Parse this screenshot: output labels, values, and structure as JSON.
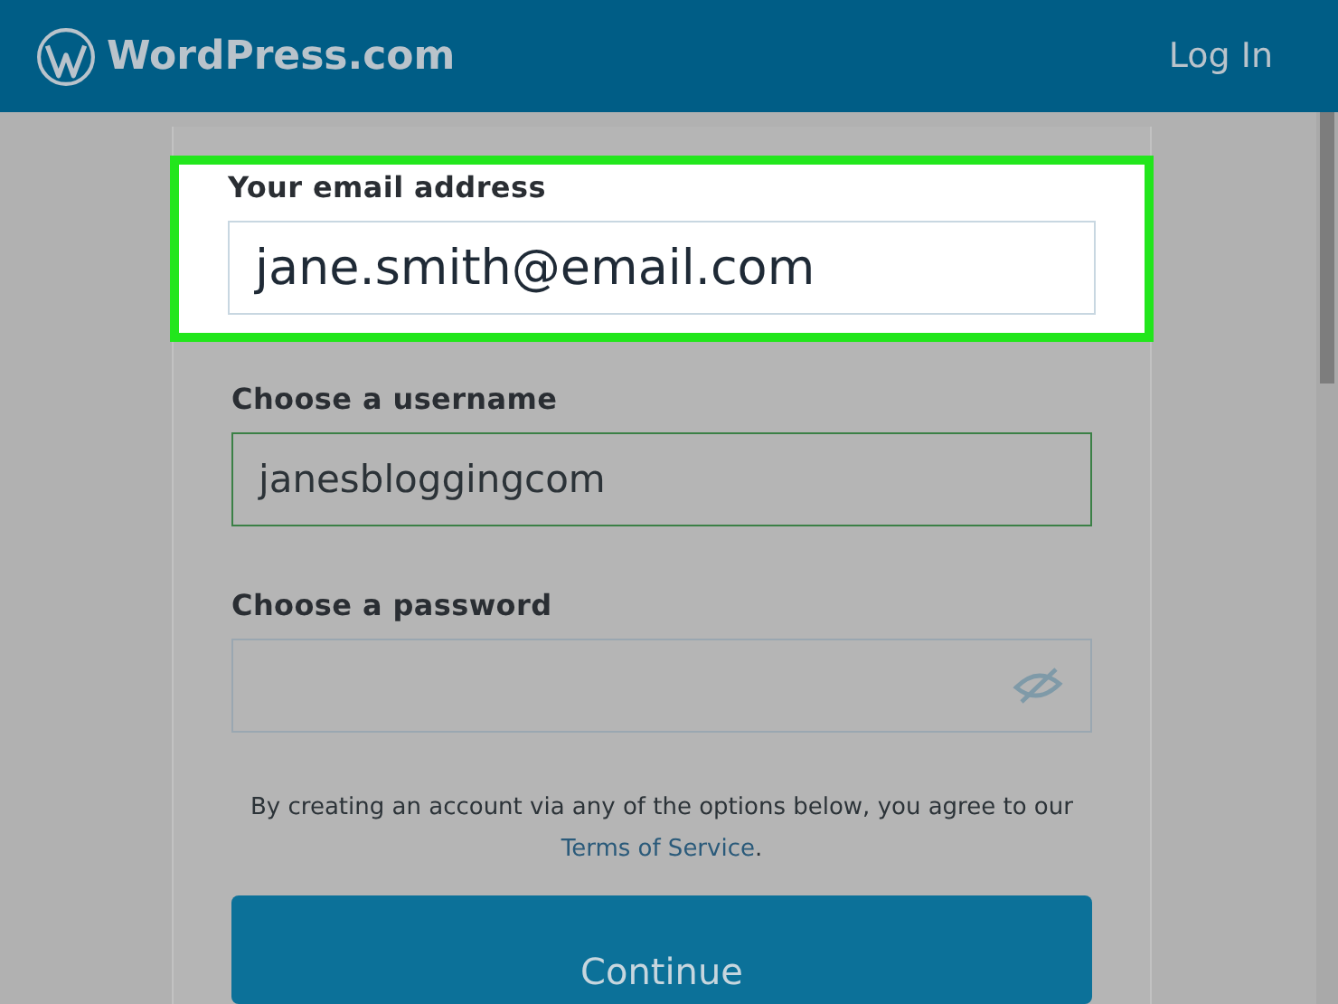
{
  "header": {
    "logo_text": "WordPress.com",
    "login_link": "Log In"
  },
  "fields": [
    {
      "kind": "text",
      "label": "Your email address",
      "value": "jane.smith@email.com",
      "highlighted": true,
      "valid": false
    },
    {
      "kind": "text",
      "label": "Choose a username",
      "value": "janesbloggingcom",
      "highlighted": false,
      "valid": true
    },
    {
      "kind": "password",
      "label": "Choose a password",
      "highlighted": false,
      "valid": false
    }
  ],
  "terms": {
    "text": "By creating an account via any of the options below, you agree to our",
    "link": "Terms of Service",
    "after": "."
  },
  "continue_button": "Continue"
}
